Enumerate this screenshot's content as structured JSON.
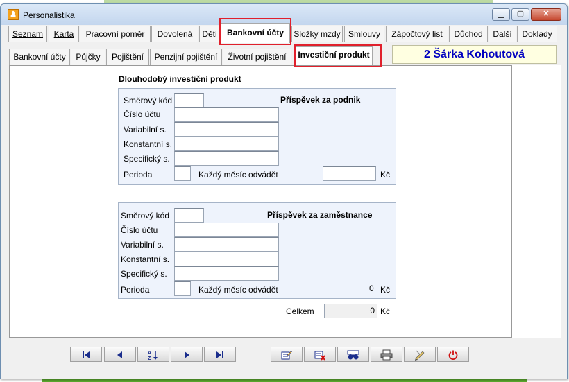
{
  "window": {
    "title": "Personalistika"
  },
  "app_name": "2 Šárka Kohoutová",
  "main_tabs": [
    {
      "label": "Seznam"
    },
    {
      "label": "Karta"
    },
    {
      "label": "Pracovní poměr"
    },
    {
      "label": "Dovolená"
    },
    {
      "label": "Děti"
    },
    {
      "label": "Bankovní účty"
    },
    {
      "label": "Složky mzdy"
    },
    {
      "label": "Smlouvy"
    },
    {
      "label": "Zápočtový list"
    },
    {
      "label": "Důchod"
    },
    {
      "label": "Další"
    },
    {
      "label": "Doklady"
    }
  ],
  "main_active": "Bankovní účty",
  "sub_tabs": [
    {
      "label": "Bankovní účty"
    },
    {
      "label": "Půjčky"
    },
    {
      "label": "Pojištění"
    },
    {
      "label": "Penzijní pojištění"
    },
    {
      "label": "Životní pojištění"
    },
    {
      "label": "Investiční produkt"
    }
  ],
  "sub_active": "Investiční produkt",
  "section": {
    "title": "Dlouhodobý investiční produkt"
  },
  "employer": {
    "heading": "Příspěvek za podnik",
    "labels": {
      "smerovy_kod": "Směrový kód",
      "cislo_uctu": "Číslo účtu",
      "variabilni": "Variabilní s.",
      "konstantni": "Konstantní s.",
      "specificky": "Specifický s.",
      "perioda": "Perioda",
      "kazdy_mesic": "Každý měsíc odvádět",
      "currency": "Kč"
    },
    "values": {
      "smerovy_kod": "",
      "cislo_uctu": "",
      "variabilni": "",
      "konstantni": "",
      "specificky": "",
      "perioda": "",
      "amount": ""
    }
  },
  "employee": {
    "heading": "Příspěvek za zaměstnance",
    "labels": {
      "smerovy_kod": "Směrový kód",
      "cislo_uctu": "Číslo účtu",
      "variabilni": "Variabilní s.",
      "konstantni": "Konstantní s.",
      "specificky": "Specifický s.",
      "perioda": "Perioda",
      "kazdy_mesic": "Každý měsíc odvádět",
      "currency": "Kč"
    },
    "values": {
      "smerovy_kod": "",
      "cislo_uctu": "",
      "variabilni": "",
      "konstantni": "",
      "specificky": "",
      "perioda": "",
      "amount": "0"
    }
  },
  "total": {
    "label": "Celkem",
    "value": "0",
    "currency": "Kč"
  },
  "toolbar": {
    "first": "first-record-icon",
    "prev": "previous-record-icon",
    "sort": "sort-az-icon",
    "next": "next-record-icon",
    "last": "last-record-icon",
    "edit": "edit-record-icon",
    "delete": "delete-record-icon",
    "find": "binoculars-icon",
    "print": "printer-icon",
    "tools": "edit-pencil-icon",
    "exit": "power-icon"
  },
  "colors": {
    "highlight": "#e0202c",
    "name_text": "#0000c0",
    "name_bg": "#ffffe1",
    "group_bg": "#eef3fc"
  }
}
